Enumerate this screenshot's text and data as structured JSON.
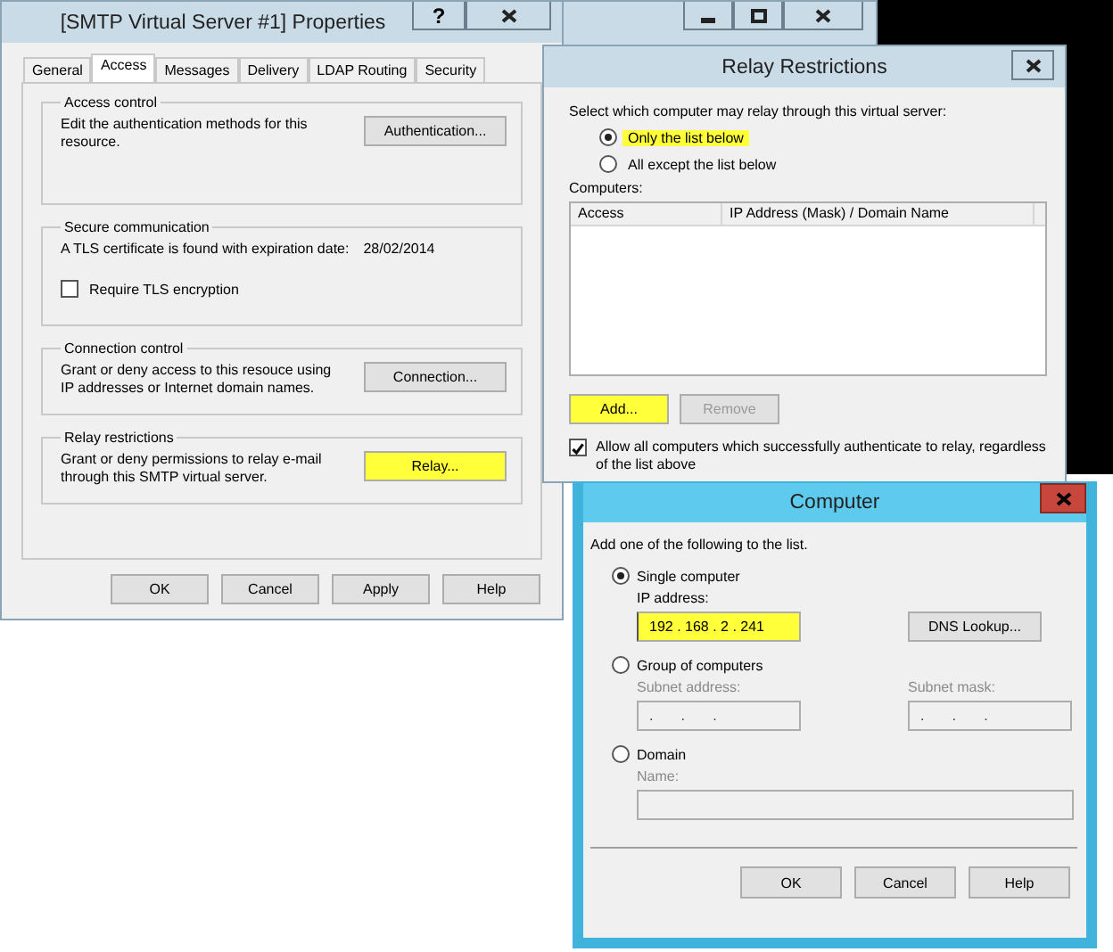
{
  "properties_window": {
    "title": "[SMTP Virtual Server #1] Properties",
    "help_label": "?",
    "tabs": [
      {
        "label": "General",
        "selected": false
      },
      {
        "label": "Access",
        "selected": true
      },
      {
        "label": "Messages",
        "selected": false
      },
      {
        "label": "Delivery",
        "selected": false
      },
      {
        "label": "LDAP Routing",
        "selected": false
      },
      {
        "label": "Security",
        "selected": false
      }
    ],
    "groups": [
      {
        "kind": "button",
        "title": "Access control",
        "text": "Edit the authentication methods for this resource.",
        "button": {
          "label": "Authentication...",
          "highlighted": false
        }
      },
      {
        "kind": "certificate",
        "title": "Secure communication",
        "text": "A TLS certificate is found with expiration date:",
        "date": "28/02/2014",
        "checkbox": {
          "label": "Require TLS encryption",
          "checked": false
        }
      },
      {
        "kind": "button",
        "title": "Connection control",
        "text": "Grant or deny access to this resouce using IP addresses or Internet domain names.",
        "button": {
          "label": "Connection...",
          "highlighted": false
        }
      },
      {
        "kind": "button",
        "title": "Relay restrictions",
        "text": "Grant or deny permissions to relay e-mail through this SMTP virtual server.",
        "button": {
          "label": "Relay...",
          "highlighted": true
        }
      }
    ],
    "buttons": [
      {
        "label": "OK"
      },
      {
        "label": "Cancel"
      },
      {
        "label": "Apply"
      },
      {
        "label": "Help"
      }
    ]
  },
  "relay_window": {
    "title": "Relay Restrictions",
    "prompt": "Select which computer may relay through this virtual server:",
    "options": [
      {
        "label": "Only the list below",
        "selected": true,
        "highlighted": true
      },
      {
        "label": "All except the list below",
        "selected": false,
        "highlighted": false
      }
    ],
    "list_label": "Computers:",
    "columns": [
      "Access",
      "IP Address (Mask) / Domain Name"
    ],
    "buttons": [
      {
        "label": "Add...",
        "disabled": false,
        "highlighted": true
      },
      {
        "label": "Remove",
        "disabled": true,
        "highlighted": false
      }
    ],
    "checkbox": {
      "label": "Allow all computers which successfully authenticate to relay, regardless of the list above",
      "checked": true
    }
  },
  "computer_window": {
    "title": "Computer",
    "prompt": "Add one of the following to the list.",
    "options": [
      {
        "label": "Single computer",
        "selected": true,
        "fields": [
          {
            "kind": "ip",
            "label": "IP address:",
            "value": "192 . 168 . 2 . 241",
            "disabled": false,
            "highlighted": true
          }
        ]
      },
      {
        "label": "Group of computers",
        "selected": false,
        "fields": [
          {
            "kind": "ip",
            "label": "Subnet address:",
            "value": ".       .       .",
            "disabled": true,
            "highlighted": false
          },
          {
            "kind": "ip",
            "label": "Subnet mask:",
            "value": ".       .       .",
            "disabled": true,
            "highlighted": false
          }
        ]
      },
      {
        "label": "Domain",
        "selected": false,
        "fields": [
          {
            "kind": "text",
            "label": "Name:",
            "disabled": true,
            "highlighted": false
          }
        ]
      }
    ],
    "lookup_button": "DNS Lookup...",
    "buttons": [
      {
        "label": "OK"
      },
      {
        "label": "Cancel"
      },
      {
        "label": "Help"
      }
    ]
  }
}
